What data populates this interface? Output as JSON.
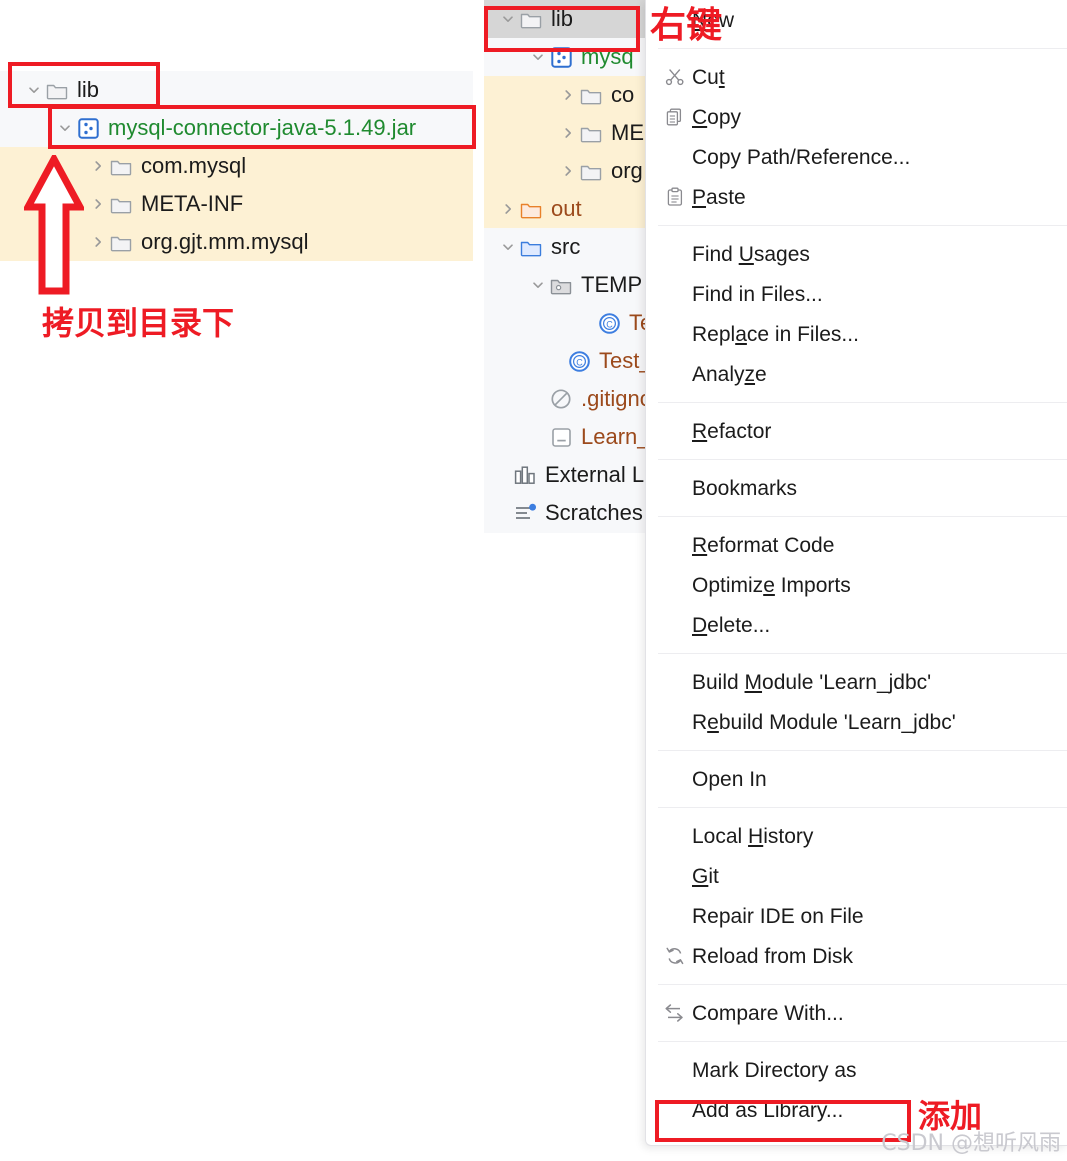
{
  "left_tree": {
    "name": "project-tree-left",
    "rows": [
      {
        "label": "lib",
        "icon": "folder-icon",
        "arrow": "chevron-down",
        "indent": 24,
        "color": "dark",
        "bg": "plain"
      },
      {
        "label": "mysql-connector-java-5.1.49.jar",
        "icon": "jar-icon",
        "arrow": "chevron-down",
        "indent": 55,
        "color": "green",
        "bg": "plain"
      },
      {
        "label": "com.mysql",
        "icon": "folder-icon",
        "arrow": "chevron-right",
        "indent": 88,
        "color": "dark",
        "bg": "tint"
      },
      {
        "label": "META-INF",
        "icon": "folder-icon",
        "arrow": "chevron-right",
        "indent": 88,
        "color": "dark",
        "bg": "tint"
      },
      {
        "label": "org.gjt.mm.mysql",
        "icon": "folder-icon",
        "arrow": "chevron-right",
        "indent": 88,
        "color": "dark",
        "bg": "tint"
      }
    ]
  },
  "mid_tree": {
    "name": "project-tree-middle",
    "rows": [
      {
        "label": "lib",
        "icon": "folder-icon",
        "arrow": "chevron-down",
        "indent": 14,
        "color": "dark",
        "bg": "sel"
      },
      {
        "label": "mysq",
        "icon": "jar-icon",
        "arrow": "chevron-down",
        "indent": 44,
        "color": "green",
        "bg": "plain"
      },
      {
        "label": "co",
        "icon": "folder-icon",
        "arrow": "chevron-right",
        "indent": 74,
        "color": "dark",
        "bg": "tint"
      },
      {
        "label": "ME",
        "icon": "folder-icon",
        "arrow": "chevron-right",
        "indent": 74,
        "color": "dark",
        "bg": "tint"
      },
      {
        "label": "org",
        "icon": "folder-icon",
        "arrow": "chevron-right",
        "indent": 74,
        "color": "dark",
        "bg": "tint"
      },
      {
        "label": "out",
        "icon": "folder-orange-icon",
        "arrow": "chevron-right",
        "indent": 14,
        "color": "brown",
        "bg": "tint"
      },
      {
        "label": "src",
        "icon": "folder-blue-icon",
        "arrow": "chevron-down",
        "indent": 14,
        "color": "dark",
        "bg": "plain"
      },
      {
        "label": "TEMP",
        "icon": "package-folder-icon",
        "arrow": "chevron-down",
        "indent": 44,
        "color": "dark",
        "bg": "plain"
      },
      {
        "label": "Te",
        "icon": "java-class-icon",
        "arrow": "none",
        "indent": 92,
        "color": "brown",
        "bg": "plain"
      },
      {
        "label": "Test_",
        "icon": "java-class-icon",
        "arrow": "none",
        "indent": 62,
        "color": "brown",
        "bg": "plain"
      },
      {
        "label": ".gitignore",
        "icon": "gitignore-icon",
        "arrow": "none",
        "indent": 44,
        "color": "brown",
        "bg": "plain"
      },
      {
        "label": "Learn_jd",
        "icon": "iml-module-icon",
        "arrow": "none",
        "indent": 44,
        "color": "brown",
        "bg": "plain"
      },
      {
        "label": "External Lib",
        "icon": "library-icon",
        "arrow": "none",
        "indent": 8,
        "color": "dark",
        "bg": "plain"
      },
      {
        "label": "Scratches a",
        "icon": "scratches-icon",
        "arrow": "none",
        "indent": 8,
        "color": "dark",
        "bg": "plain"
      }
    ]
  },
  "context_menu": {
    "name": "editor-context-menu",
    "groups": [
      {
        "items": [
          {
            "label": "New",
            "icon": "none",
            "mnemonic_index": 0
          }
        ]
      },
      {
        "items": [
          {
            "label": "Cut",
            "icon": "scissors-icon",
            "mnemonic_index": 2
          },
          {
            "label": "Copy",
            "icon": "copy-icon",
            "mnemonic_index": 0
          },
          {
            "label": "Copy Path/Reference...",
            "icon": "none",
            "mnemonic_index": -1
          },
          {
            "label": "Paste",
            "icon": "clipboard-icon",
            "mnemonic_index": 0
          }
        ]
      },
      {
        "items": [
          {
            "label": "Find Usages",
            "icon": "none",
            "mnemonic_index": 5
          },
          {
            "label": "Find in Files...",
            "icon": "none",
            "mnemonic_index": -1
          },
          {
            "label": "Replace in Files...",
            "icon": "none",
            "mnemonic_index": 4
          },
          {
            "label": "Analyze",
            "icon": "none",
            "mnemonic_index": 5
          }
        ]
      },
      {
        "items": [
          {
            "label": "Refactor",
            "icon": "none",
            "mnemonic_index": 0
          }
        ]
      },
      {
        "items": [
          {
            "label": "Bookmarks",
            "icon": "none",
            "mnemonic_index": -1
          }
        ]
      },
      {
        "items": [
          {
            "label": "Reformat Code",
            "icon": "none",
            "mnemonic_index": 0
          },
          {
            "label": "Optimize Imports",
            "icon": "none",
            "mnemonic_index": 7
          },
          {
            "label": "Delete...",
            "icon": "none",
            "mnemonic_index": 0
          }
        ]
      },
      {
        "items": [
          {
            "label": "Build Module 'Learn_jdbc'",
            "icon": "none",
            "mnemonic_index": 6
          },
          {
            "label": "Rebuild Module 'Learn_jdbc'",
            "icon": "none",
            "mnemonic_index": 1
          }
        ]
      },
      {
        "items": [
          {
            "label": "Open In",
            "icon": "none",
            "mnemonic_index": -1
          }
        ]
      },
      {
        "items": [
          {
            "label": "Local History",
            "icon": "none",
            "mnemonic_index": 6
          },
          {
            "label": "Git",
            "icon": "none",
            "mnemonic_index": 0
          },
          {
            "label": "Repair IDE on File",
            "icon": "none",
            "mnemonic_index": -1
          },
          {
            "label": "Reload from Disk",
            "icon": "reload-icon",
            "mnemonic_index": -1
          }
        ]
      },
      {
        "items": [
          {
            "label": "Compare With...",
            "icon": "compare-icon",
            "mnemonic_index": -1
          }
        ]
      },
      {
        "items": [
          {
            "label": "Mark Directory as",
            "icon": "none",
            "mnemonic_index": -1
          },
          {
            "label": "Add as Library...",
            "icon": "none",
            "mnemonic_index": -1
          }
        ]
      }
    ]
  },
  "annotations": {
    "copy_to_dir": "拷贝到目录下",
    "right_click": "右键",
    "add": "添加",
    "accent_color": "#ee1b24"
  },
  "watermark": "CSDN @想听风雨"
}
